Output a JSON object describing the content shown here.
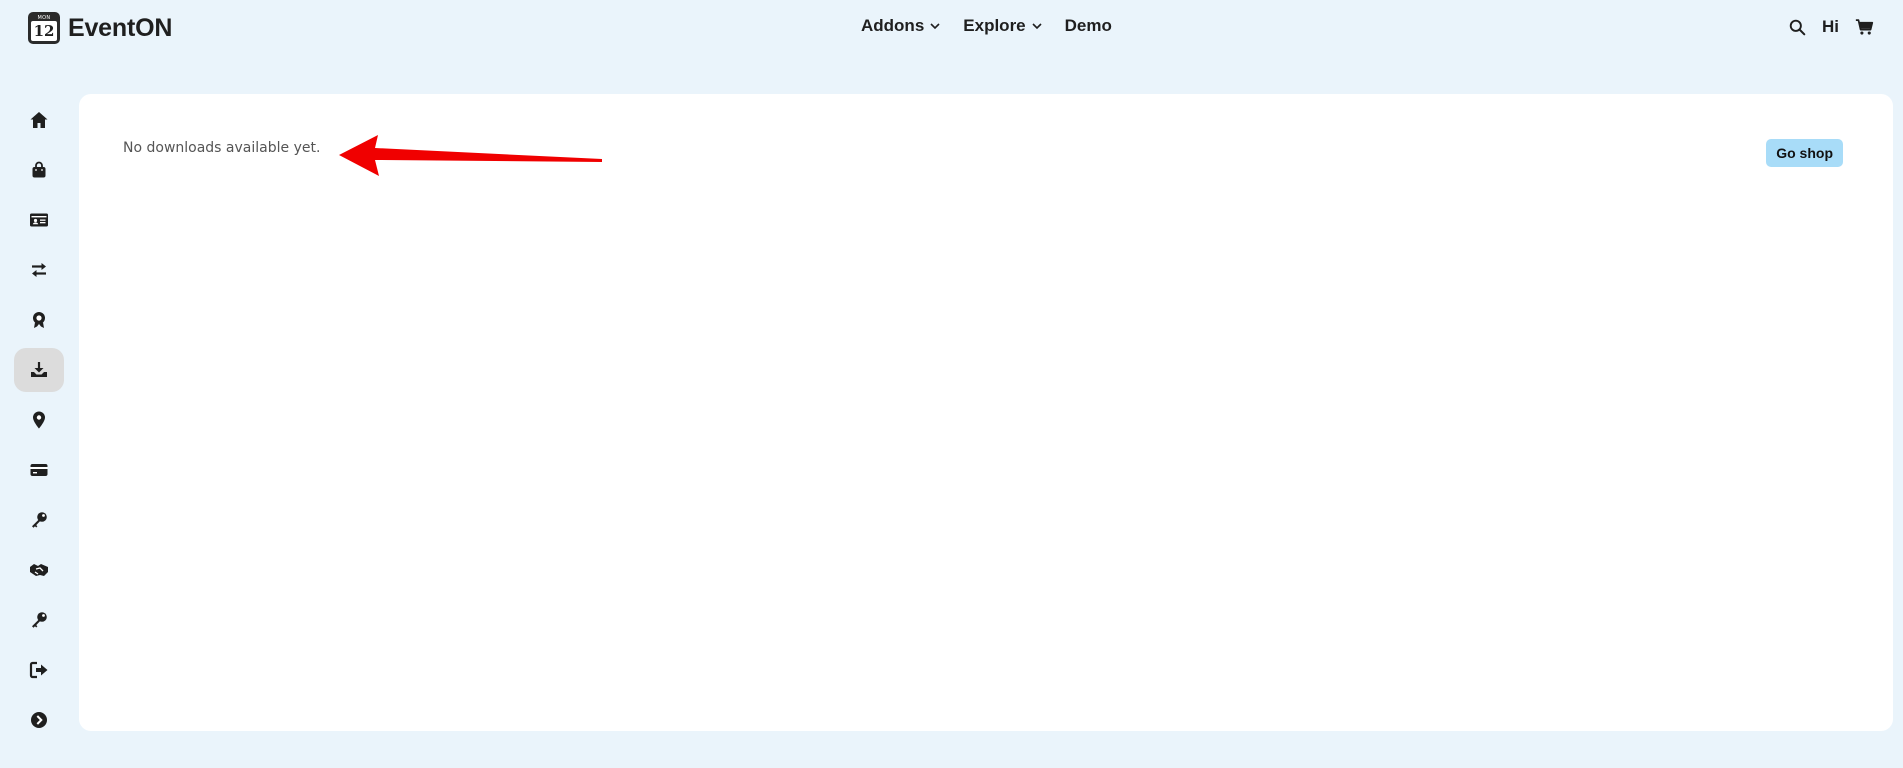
{
  "header": {
    "logo": {
      "month": "MON",
      "day": "12",
      "name": "EventON"
    },
    "nav": [
      {
        "label": "Addons",
        "has_dropdown": true
      },
      {
        "label": "Explore",
        "has_dropdown": true
      },
      {
        "label": "Demo",
        "has_dropdown": false
      }
    ],
    "greeting": "Hi",
    "icons": [
      "search-icon",
      "cart-icon"
    ]
  },
  "sidebar": {
    "items": [
      {
        "name": "dashboard",
        "icon": "home-icon",
        "active": false
      },
      {
        "name": "orders",
        "icon": "shopping-bag-icon",
        "active": false
      },
      {
        "name": "account-details",
        "icon": "id-card-icon",
        "active": false
      },
      {
        "name": "subscriptions",
        "icon": "exchange-arrows-icon",
        "active": false
      },
      {
        "name": "licenses",
        "icon": "award-icon",
        "active": false
      },
      {
        "name": "downloads",
        "icon": "download-icon",
        "active": true
      },
      {
        "name": "addresses",
        "icon": "location-pin-icon",
        "active": false
      },
      {
        "name": "payment-methods",
        "icon": "credit-card-icon",
        "active": false
      },
      {
        "name": "license-keys",
        "icon": "key-icon",
        "active": false
      },
      {
        "name": "affiliate",
        "icon": "handshake-icon",
        "active": false
      },
      {
        "name": "api-keys",
        "icon": "key-icon",
        "active": false
      },
      {
        "name": "logout",
        "icon": "logout-icon",
        "active": false
      },
      {
        "name": "collapse",
        "icon": "chevron-circle-right-icon",
        "active": false
      }
    ]
  },
  "main": {
    "empty_message": "No downloads available yet.",
    "go_shop_label": "Go shop"
  },
  "colors": {
    "page_background": "#eaf4fb",
    "panel_background": "#ffffff",
    "button_background": "#a8dcf8",
    "annotation_arrow": "#f00000",
    "active_sidebar_item": "#dcdcdc"
  }
}
